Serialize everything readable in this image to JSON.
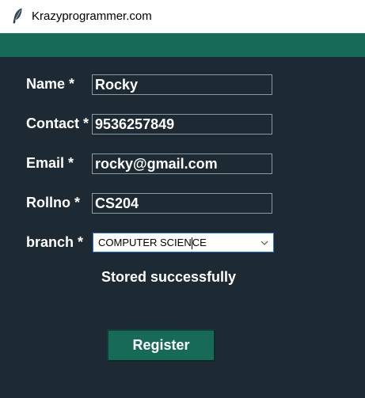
{
  "window": {
    "title": "Krazyprogrammer.com",
    "icon": "feather-icon"
  },
  "form": {
    "name_label": "Name *",
    "name_value": "Rocky",
    "contact_label": "Contact *",
    "contact_value": "9536257849",
    "email_label": "Email *",
    "email_value": "rocky@gmail.com",
    "rollno_label": "Rollno *",
    "rollno_value": "CS204",
    "branch_label": "branch *",
    "branch_value_before_caret": "COMPUTER SCIEN",
    "branch_value_after_caret": "CE",
    "branch_icon": "chevron-down-icon"
  },
  "status_message": "Stored successfully",
  "register_label": "Register",
  "colors": {
    "background": "#1e2a33",
    "accent": "#176a57",
    "text": "#ffffff"
  }
}
